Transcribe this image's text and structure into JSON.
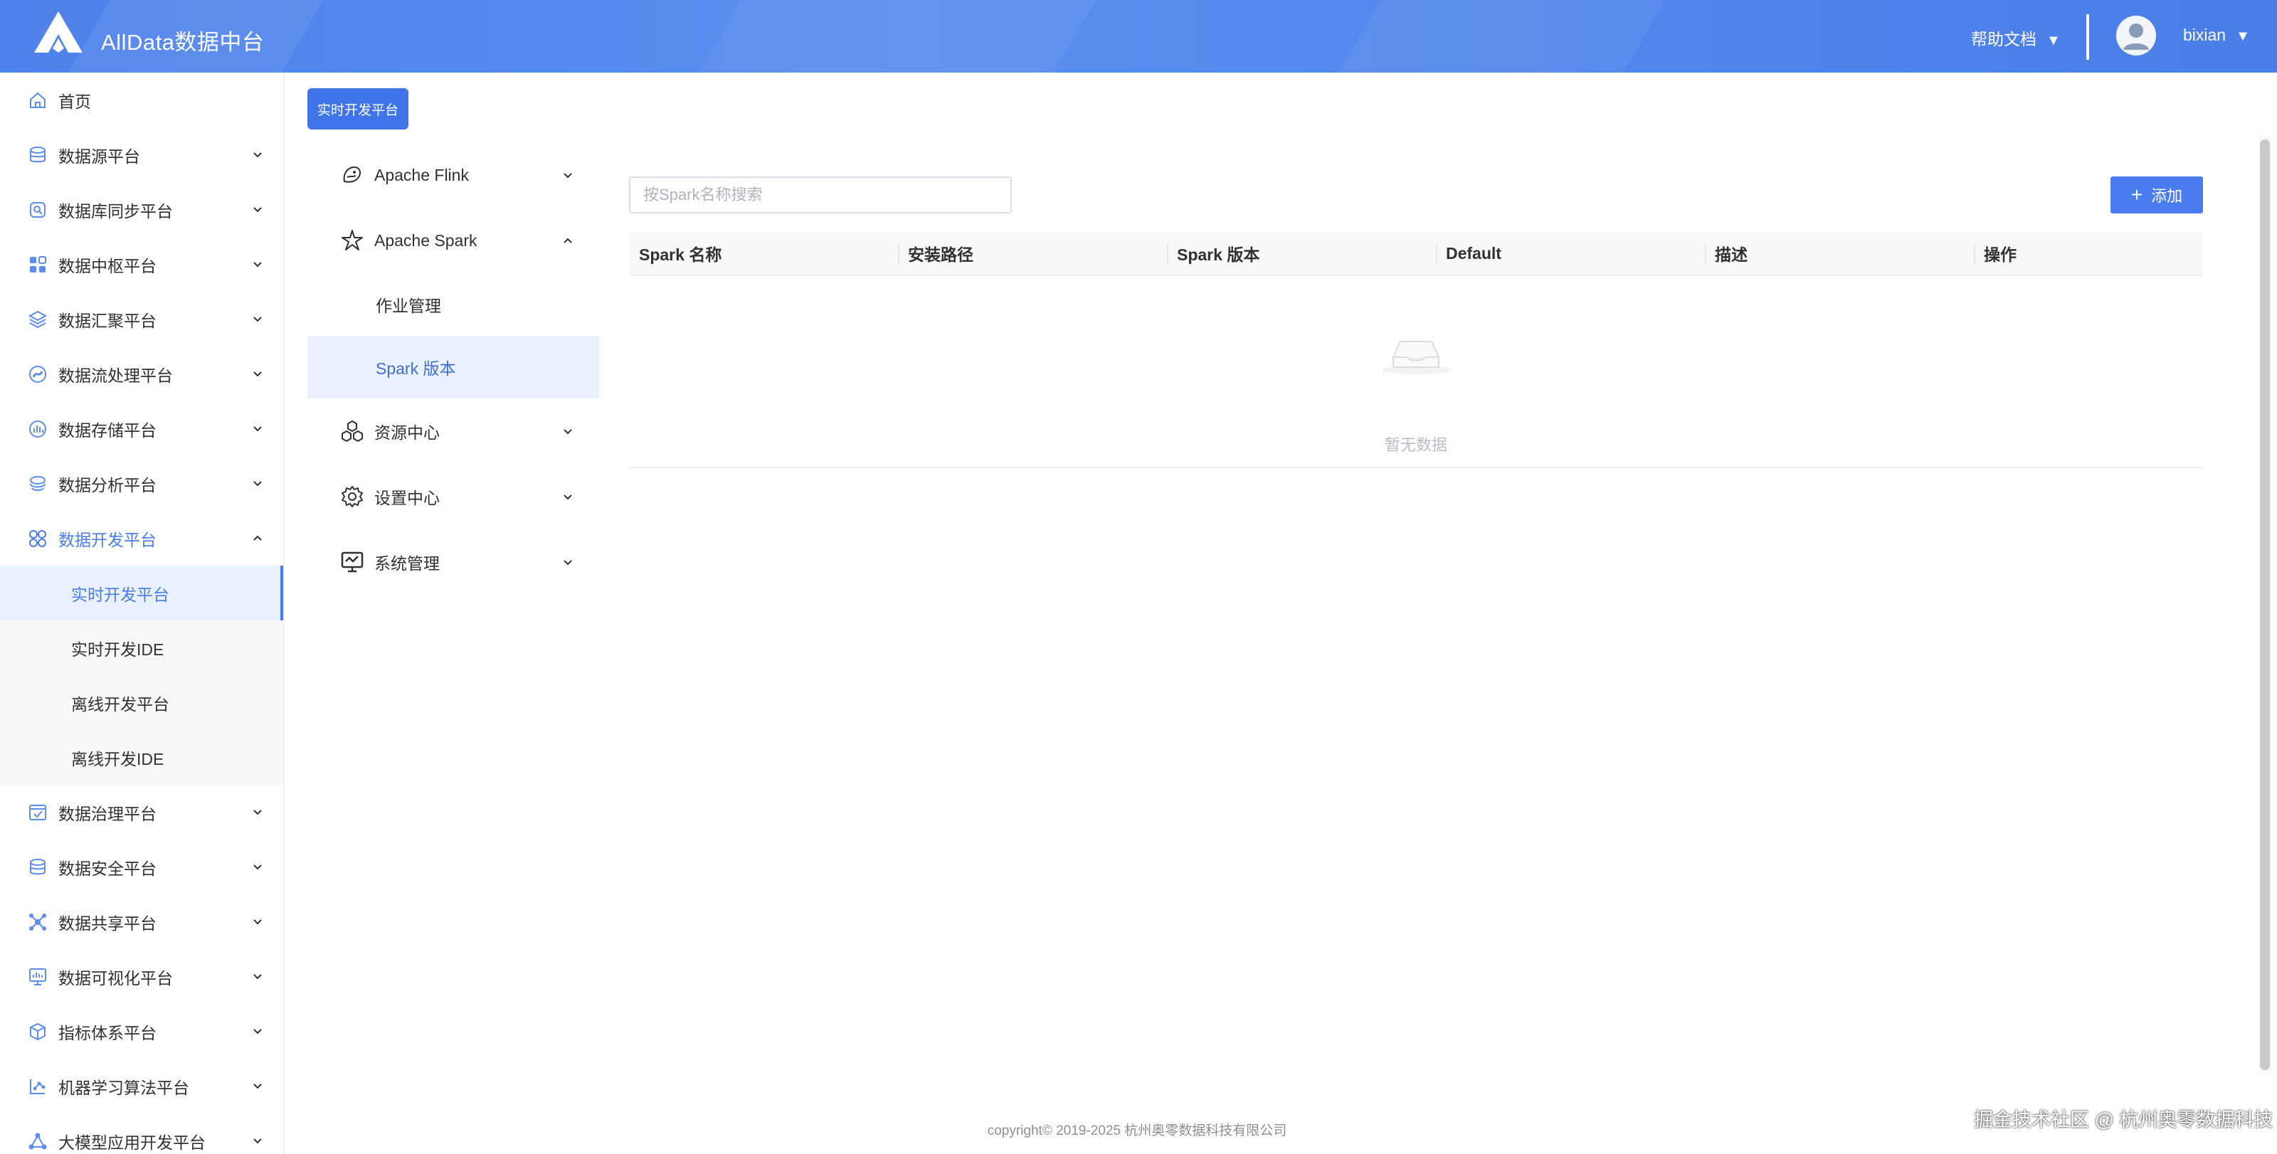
{
  "header": {
    "brand": "AllData数据中台",
    "help_label": "帮助文档",
    "user_name": "bixian",
    "caret": "▼"
  },
  "sidebar": {
    "items": [
      {
        "label": "首页",
        "icon": "home-icon"
      },
      {
        "label": "数据源平台",
        "icon": "database-icon"
      },
      {
        "label": "数据库同步平台",
        "icon": "sync-icon"
      },
      {
        "label": "数据中枢平台",
        "icon": "grid-icon"
      },
      {
        "label": "数据汇聚平台",
        "icon": "layers-icon"
      },
      {
        "label": "数据流处理平台",
        "icon": "stream-icon"
      },
      {
        "label": "数据存储平台",
        "icon": "storage-icon"
      },
      {
        "label": "数据分析平台",
        "icon": "analysis-icon"
      },
      {
        "label": "数据开发平台",
        "icon": "dev-icon"
      },
      {
        "label": "数据治理平台",
        "icon": "governance-icon"
      },
      {
        "label": "数据安全平台",
        "icon": "security-icon"
      },
      {
        "label": "数据共享平台",
        "icon": "share-icon"
      },
      {
        "label": "数据可视化平台",
        "icon": "visual-icon"
      },
      {
        "label": "指标体系平台",
        "icon": "cube-icon"
      },
      {
        "label": "机器学习算法平台",
        "icon": "ml-icon"
      },
      {
        "label": "大模型应用开发平台",
        "icon": "llm-icon"
      }
    ],
    "sub_items": [
      {
        "label": "实时开发平台"
      },
      {
        "label": "实时开发IDE"
      },
      {
        "label": "离线开发平台"
      },
      {
        "label": "离线开发IDE"
      }
    ]
  },
  "tag_button": "实时开发平台",
  "menu2": {
    "flink": "Apache Flink",
    "spark": "Apache Spark",
    "spark_sub": [
      "作业管理",
      "Spark 版本"
    ],
    "resource": "资源中心",
    "settings": "设置中心",
    "system": "系统管理"
  },
  "search": {
    "placeholder": "按Spark名称搜索"
  },
  "add_button": "添加",
  "table": {
    "columns": [
      "Spark 名称",
      "安装路径",
      "Spark 版本",
      "Default",
      "描述",
      "操作"
    ],
    "rows": [],
    "empty_text": "暂无数据"
  },
  "footer": "copyright© 2019-2025 杭州奥零数据科技有限公司",
  "watermark": "掘金技术社区 @ 杭州奥零数据科技",
  "colors": {
    "accent": "#4a7cf0",
    "header": "#5b8ef0"
  }
}
